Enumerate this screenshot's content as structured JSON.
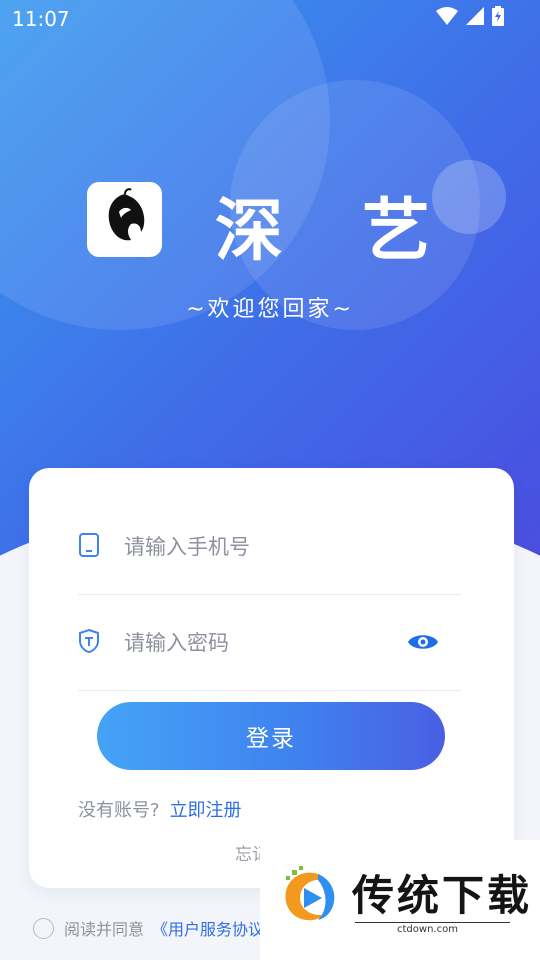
{
  "status_bar": {
    "time": "11:07"
  },
  "brand": {
    "char1": "深",
    "char2": "艺",
    "welcome": "~欢迎您回家~"
  },
  "form": {
    "phone_placeholder": "请输入手机号",
    "password_placeholder": "请输入密码",
    "login_label": "登录",
    "no_account": "没有账号?",
    "register_link": "立即注册",
    "forgot_password": "忘记"
  },
  "agreement": {
    "text": "阅读并同意",
    "link": "《用户服务协议"
  },
  "watermark": {
    "title": "传统下载",
    "url": "ctdown.com"
  },
  "colors": {
    "primary_gradient_start": "#3a9af0",
    "primary_gradient_end": "#4a4ee0",
    "link": "#2f6fe6"
  }
}
